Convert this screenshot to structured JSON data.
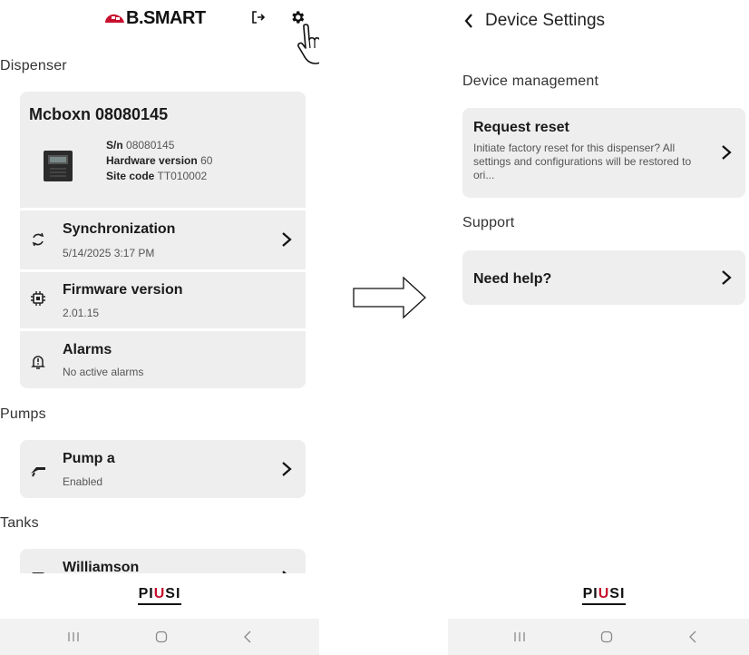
{
  "left": {
    "logo_text": "B.SMART",
    "sections": {
      "dispenser": "Dispenser",
      "pumps": "Pumps",
      "tanks": "Tanks"
    },
    "device": {
      "name": "Mcboxn 08080145",
      "sn_label": "S/n",
      "sn_value": "08080145",
      "hw_label": "Hardware version",
      "hw_value": "60",
      "site_label": "Site code",
      "site_value": "TT010002"
    },
    "rows": {
      "sync_title": "Synchronization",
      "sync_sub": "5/14/2025 3:17 PM",
      "fw_title": "Firmware version",
      "fw_sub": "2.01.15",
      "alarms_title": "Alarms",
      "alarms_sub": "No active alarms",
      "pump_title": "Pump a",
      "pump_sub": "Enabled",
      "tank_title": "Williamson"
    },
    "footer_brand_a": "PI",
    "footer_brand_b": "U",
    "footer_brand_c": "SI"
  },
  "right": {
    "title": "Device Settings",
    "section_management": "Device management",
    "reset_title": "Request reset",
    "reset_desc": "Initiate factory reset for this dispenser? All settings and configurations will be restored to ori...",
    "section_support": "Support",
    "help_title": "Need help?",
    "footer_brand_a": "PI",
    "footer_brand_b": "U",
    "footer_brand_c": "SI"
  },
  "colors": {
    "card_bg": "#eeeeee",
    "brand_red": "#c8102e",
    "navbar_bg": "#f2f2f2"
  },
  "icons": [
    "logout-icon",
    "gear-icon",
    "pointing-hand-icon",
    "sync-icon",
    "chip-icon",
    "bell-alert-icon",
    "fuel-nozzle-icon",
    "tank-icon",
    "chevron-right-icon",
    "chevron-left-icon",
    "arrow-right-icon"
  ]
}
